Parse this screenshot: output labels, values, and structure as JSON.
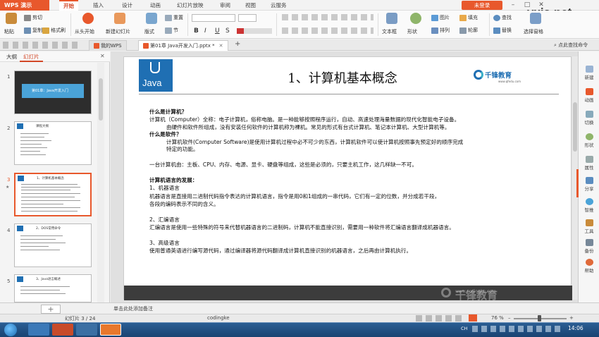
{
  "app": {
    "menu_label": "WPS 演示",
    "tabs": [
      "开始",
      "插入",
      "设计",
      "动画",
      "幻灯片放映",
      "审阅",
      "视图",
      "云服务"
    ],
    "active_tab": "开始",
    "account": "未登录",
    "watermark": "vxia.net"
  },
  "ribbon": {
    "paste": "粘贴",
    "cut": "剪切",
    "copy": "复制",
    "format_painter": "格式刷",
    "from_start": "从头开始",
    "new_slide": "新建幻灯片",
    "layout": "版式",
    "reset": "重置",
    "section": "节",
    "font_bold": "B",
    "font_italic": "I",
    "font_underline": "U",
    "font_shadow": "S",
    "textbox": "文本框",
    "shape": "形状",
    "picture": "图片",
    "fill": "填充",
    "arrange": "排列",
    "outline": "轮廓",
    "find": "查找",
    "replace": "替换",
    "select_pane": "选择窗格"
  },
  "doc_tabs": {
    "home": "我的WPS",
    "file": "第01章 Java开发入门.pptx *",
    "search_hint": "点此查找命令"
  },
  "left_panel": {
    "tab_outline": "大纲",
    "tab_slides": "幻灯片",
    "thumbnails": [
      {
        "num": "1",
        "title": "第01章：Java开发入门"
      },
      {
        "num": "2",
        "title": "课程大纲"
      },
      {
        "num": "3",
        "title": "1、计算机基本概念"
      },
      {
        "num": "4",
        "title": "2、DOS常用命令"
      },
      {
        "num": "5",
        "title": "3、Java语言概述"
      }
    ]
  },
  "slide": {
    "logo_text": "Java",
    "title": "1、计算机基本概念",
    "brand": "千锋教育",
    "brand_sub": "www.qfedu.com",
    "footer_watermark": "千锋教育",
    "footer_url": "www.codingke.com",
    "lines": [
      {
        "text": "什么是计算机？",
        "bold": true,
        "indent": false
      },
      {
        "text": "计算机（Computer）全称：电子计算机，俗称电脑。是一种能够按照程序运行，自动、高速处理海量数据的现代化智能电子设备。",
        "bold": false,
        "indent": false
      },
      {
        "text": "由硬件和软件所组成，没有安装任何软件的计算机称为裸机。常见的形式有台式计算机、笔记本计算机、大型计算机等。",
        "bold": false,
        "indent": true
      },
      {
        "text": "什么是软件？",
        "bold": true,
        "indent": false
      },
      {
        "text": "计算机软件(Computer Software)是使用计算机过程中必不可少的东西，计算机软件可以使计算机按照事先预定好的顺序完成",
        "bold": false,
        "indent": true
      },
      {
        "text": "特定的功能。",
        "bold": false,
        "indent": true
      },
      {
        "text": "一台计算机由：主板、CPU、内存、电源、显卡、硬盘等组成，这些是必须的，只要主机工作，这几样缺一不可。",
        "bold": false,
        "indent": false
      },
      {
        "text": "计算机语言的发展：",
        "bold": true,
        "indent": false
      },
      {
        "text": "1、机器语言",
        "bold": false,
        "indent": false
      },
      {
        "text": "机器语言是直接用二进制代码指令表达的计算机语言，指令是用0和1组成的一串代码，它们有一定的位数，并分成若干段，",
        "bold": false,
        "indent": false
      },
      {
        "text": "各段的编码表示不同的含义。",
        "bold": false,
        "indent": false
      },
      {
        "text": "2、汇编语言",
        "bold": false,
        "indent": false
      },
      {
        "text": "汇编语言是使用一些特殊的符号来代替机器语言的二进制码，计算机不能直接识别，需要用一种软件将汇编语言翻译成机器语言。",
        "bold": false,
        "indent": false
      },
      {
        "text": "3、高级语言",
        "bold": false,
        "indent": false
      },
      {
        "text": "使用普通英语进行编写源代码，通过编译器将源代码翻译成计算机直接识别的机器语言，之后再由计算机执行。",
        "bold": false,
        "indent": false
      }
    ]
  },
  "right_panel": [
    "新建",
    "动画",
    "切换",
    "形状",
    "属性",
    "分享",
    "智推",
    "工具",
    "备份",
    "帮助"
  ],
  "notes_placeholder": "单击此处添加备注",
  "status": {
    "slide_count": "幻灯片 3 / 24",
    "author": "codingke",
    "zoom": "76 %"
  },
  "taskbar": {
    "lang": "CH",
    "time": "14:06"
  },
  "colors": {
    "accent": "#e8582c",
    "java_blue": "#1f6fb3"
  }
}
